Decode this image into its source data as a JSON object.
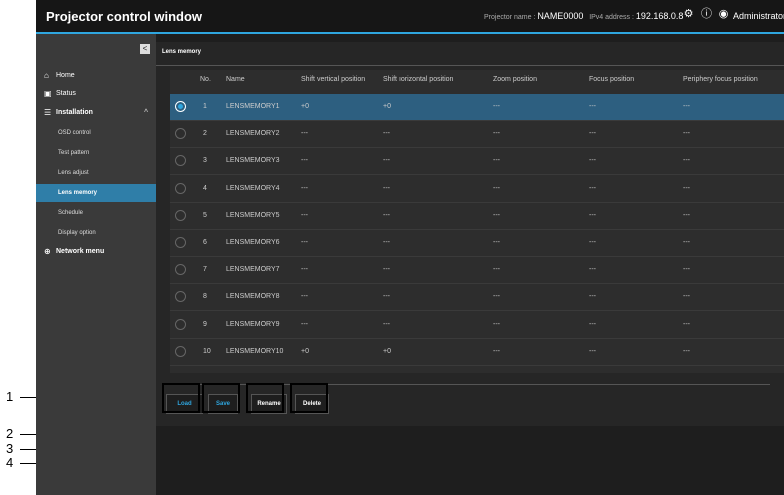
{
  "header": {
    "title": "Projector control window",
    "projector_name_label": "Projector name :",
    "projector_name": "NAME0000",
    "ipv4_label": "IPv4 address :",
    "ipv4": "192.168.0.8",
    "user": "Administrator",
    "icons": [
      "gear-icon",
      "info-icon",
      "user-icon"
    ]
  },
  "sidebar": {
    "collapse": "<",
    "items": [
      {
        "label": "Home",
        "icon": "home-icon"
      },
      {
        "label": "Status",
        "icon": "status-icon"
      },
      {
        "label": "Installation",
        "icon": "sliders-icon"
      },
      {
        "label": "OSD control"
      },
      {
        "label": "Test pattern"
      },
      {
        "label": "Lens adjust"
      },
      {
        "label": "Lens memory"
      },
      {
        "label": "Schedule"
      },
      {
        "label": "Display option"
      },
      {
        "label": "Network menu",
        "icon": "globe-icon"
      }
    ]
  },
  "panel": {
    "title": "Lens memory",
    "columns": [
      "No.",
      "Name",
      "Shift vertical position",
      "Shift ıorizontal position",
      "Zoom position",
      "Focus position",
      "Periphery focus position"
    ],
    "rows": [
      {
        "no": "1",
        "name": "LENSMEMORY1",
        "sv": "+0",
        "sh": "+0",
        "zoom": "---",
        "focus": "---",
        "periph": "---"
      },
      {
        "no": "2",
        "name": "LENSMEMORY2",
        "sv": "---",
        "sh": "---",
        "zoom": "---",
        "focus": "---",
        "periph": "---"
      },
      {
        "no": "3",
        "name": "LENSMEMORY3",
        "sv": "---",
        "sh": "---",
        "zoom": "---",
        "focus": "---",
        "periph": "---"
      },
      {
        "no": "4",
        "name": "LENSMEMORY4",
        "sv": "---",
        "sh": "---",
        "zoom": "---",
        "focus": "---",
        "periph": "---"
      },
      {
        "no": "5",
        "name": "LENSMEMORY5",
        "sv": "---",
        "sh": "---",
        "zoom": "---",
        "focus": "---",
        "periph": "---"
      },
      {
        "no": "6",
        "name": "LENSMEMORY6",
        "sv": "---",
        "sh": "---",
        "zoom": "---",
        "focus": "---",
        "periph": "---"
      },
      {
        "no": "7",
        "name": "LENSMEMORY7",
        "sv": "---",
        "sh": "---",
        "zoom": "---",
        "focus": "---",
        "periph": "---"
      },
      {
        "no": "8",
        "name": "LENSMEMORY8",
        "sv": "---",
        "sh": "---",
        "zoom": "---",
        "focus": "---",
        "periph": "---"
      },
      {
        "no": "9",
        "name": "LENSMEMORY9",
        "sv": "---",
        "sh": "---",
        "zoom": "---",
        "focus": "---",
        "periph": "---"
      },
      {
        "no": "10",
        "name": "LENSMEMORY10",
        "sv": "+0",
        "sh": "+0",
        "zoom": "---",
        "focus": "---",
        "periph": "---"
      }
    ],
    "selected_row": "1",
    "buttons": {
      "load": "Load",
      "save": "Save",
      "rename": "Rename",
      "delete": "Delete"
    }
  },
  "callouts": [
    "1",
    "2",
    "3",
    "4"
  ],
  "colors": {
    "accent": "#2fa6df",
    "active_nav": "#2f7ea8",
    "selected_row": "#2d5f80"
  }
}
